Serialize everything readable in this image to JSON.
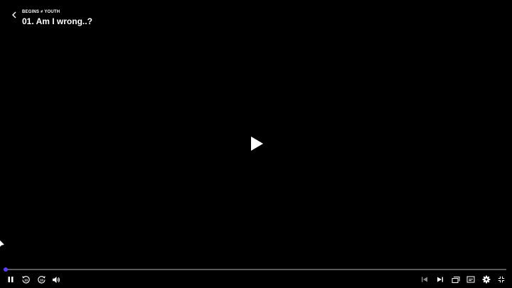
{
  "header": {
    "series_title": "BEGINS ≠ YOUTH",
    "episode_title": "01. Am I wrong..?"
  },
  "player": {
    "progress_fraction": 0.0,
    "accent_color": "#5b3dff",
    "rewind_seconds": "10",
    "forward_seconds": "10"
  },
  "controls": {
    "left": [
      "pause-icon",
      "rewind-10-icon",
      "forward-10-icon",
      "volume-icon"
    ],
    "right": [
      "skip-previous-icon",
      "skip-next-icon",
      "episodes-icon",
      "subtitles-icon",
      "settings-gear-icon",
      "exit-fullscreen-icon"
    ]
  }
}
